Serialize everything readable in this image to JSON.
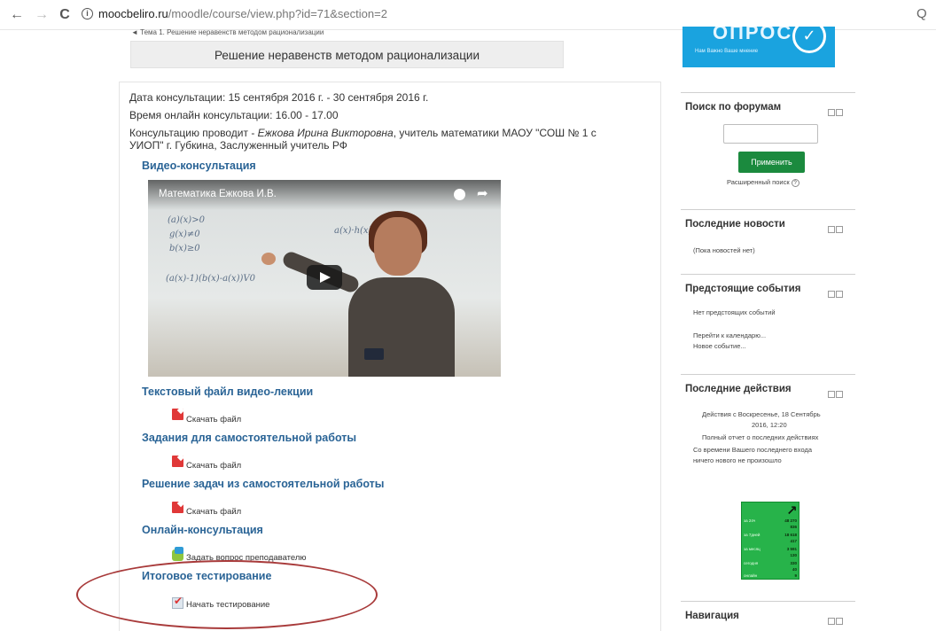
{
  "browser": {
    "back_label": "←",
    "forward_label": "→",
    "reload_label": "C",
    "info_label": "i",
    "url_host": "moocbeliro.ru",
    "url_path": "/moodle/course/view.php?id=71&section=2",
    "zoom_label": "Q"
  },
  "breadcrumb": {
    "prev_section": "◄ Тема 1. Решение неравенств методом рационализации"
  },
  "section": {
    "title": "Решение неравенств методом рационализации"
  },
  "promo": {
    "big_text": "ОПРОС",
    "small_text": "Нам Важно Ваше мнение",
    "circle_label": "✓"
  },
  "consult": {
    "date_line": "Дата консультации: 15 сентября 2016 г. - 30 сентября 2016 г.",
    "time_line": "Время онлайн консультации: 16.00 - 17.00",
    "by_prefix": "Консультацию проводит - ",
    "by_name": "Ежкова Ирина Викторовна",
    "by_suffix": ", учитель математики МАОУ \"СОШ № 1 с",
    "by_line2": "УИОП\" г. Губкина, Заслуженный учитель РФ"
  },
  "video": {
    "heading": "Видео-консультация",
    "title": "Математика Ежкова И.В.",
    "board_lines": [
      "(a)(x)>0",
      "g(x)≠0",
      "b(x)≥0",
      "a(x)·h(x)>0",
      "(a(x)-1)(b(x)-a(x))V0"
    ]
  },
  "sections": [
    {
      "title": "Текстовый файл видео-лекции",
      "link": "Скачать файл"
    },
    {
      "title": "Задания для самостоятельной работы",
      "link": "Скачать файл"
    },
    {
      "title": "Решение задач из самостоятельной работы",
      "link": "Скачать файл"
    },
    {
      "title": "Онлайн-консультация",
      "link": "Задать вопрос преподавателю"
    },
    {
      "title": "Итоговое тестирование",
      "link": "Начать тестирование"
    }
  ],
  "blocks": {
    "forum_search": {
      "title": "Поиск по форумам",
      "search_value": "",
      "apply_label": "Применить",
      "advanced_label": "Расширенный поиск",
      "help_label": "?"
    },
    "news": {
      "title": "Последние новости",
      "text": "(Пока новостей нет)"
    },
    "events": {
      "title": "Предстоящие события",
      "text": "Нет предстоящих событий",
      "calendar_link": "Перейти к календарю...",
      "new_event_link": "Новое событие..."
    },
    "activity": {
      "title": "Последние действия",
      "line1": "Действия с Воскресенье, 18 Сентябрь",
      "line2": "2016, 12:20",
      "line3": "Полный отчет о последних действиях",
      "line4": "Со времени Вашего последнего входа",
      "line5": "ничего нового не произошло"
    },
    "navigation": {
      "title": "Навигация"
    }
  },
  "counter": {
    "arrow": "↗",
    "rows": [
      {
        "label": "за 24ч",
        "value": "48 270"
      },
      {
        "label": "",
        "value": "836"
      },
      {
        "label": "за 7дней",
        "value": "18 618"
      },
      {
        "label": "",
        "value": "417"
      },
      {
        "label": "за месяц",
        "value": "3 591"
      },
      {
        "label": "",
        "value": "130"
      },
      {
        "label": "сегодня",
        "value": "330"
      },
      {
        "label": "",
        "value": "40"
      },
      {
        "label": "онлайн",
        "value": "9"
      }
    ]
  },
  "colors": {
    "link_blue": "#2a6496",
    "apply_green": "#1b8a3e",
    "promo_blue": "#1aa3df",
    "annotation_red": "#a83a3a"
  }
}
